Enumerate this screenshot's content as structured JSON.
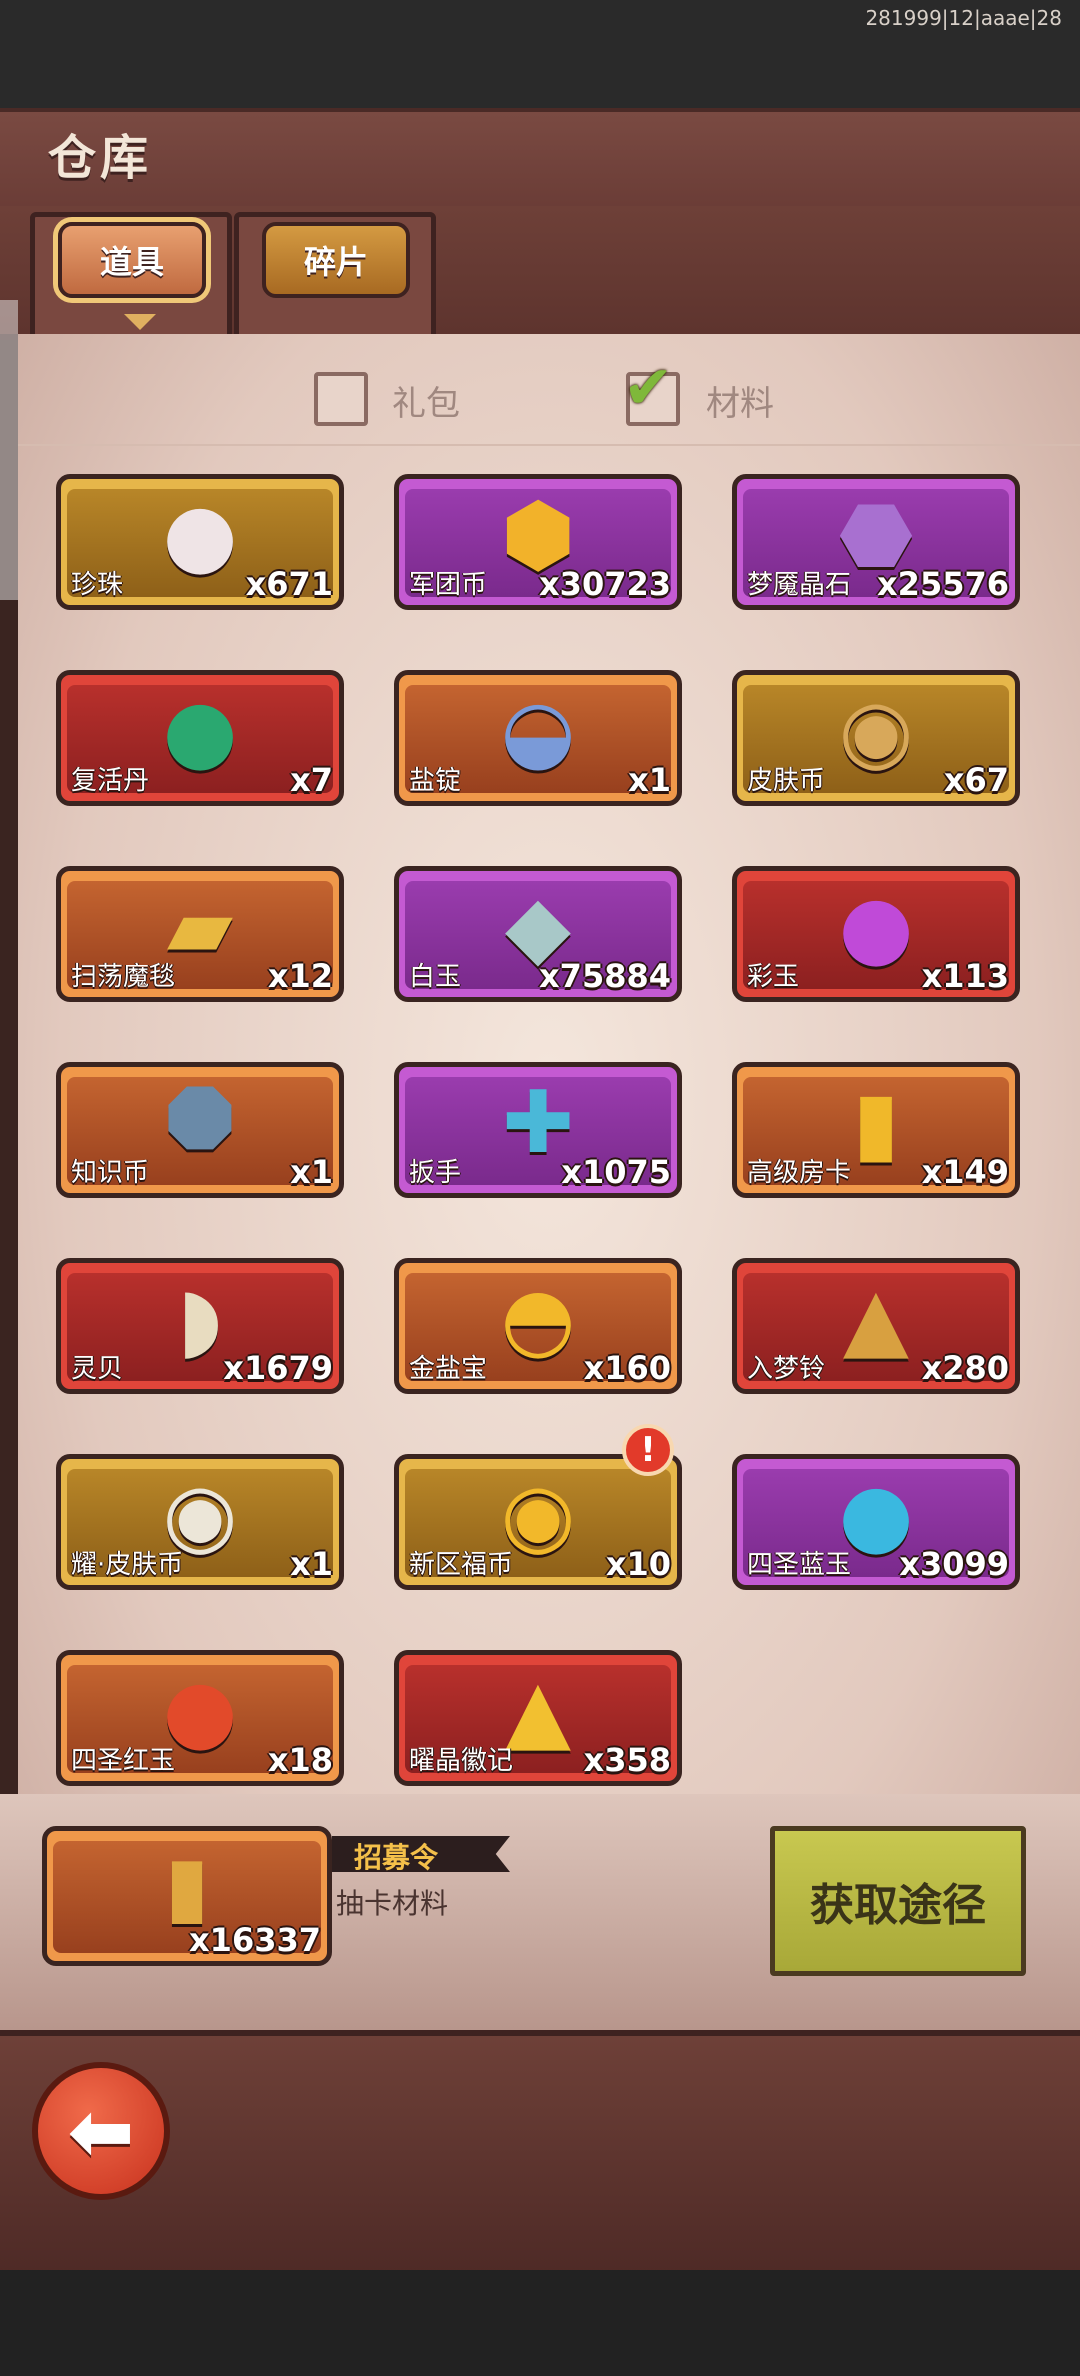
{
  "status_bar": {
    "build_info": "281999|12|aaae|28"
  },
  "header": {
    "title": "仓库"
  },
  "tabs": [
    {
      "label": "道具",
      "active": true
    },
    {
      "label": "碎片",
      "active": false
    }
  ],
  "filters": [
    {
      "label": "礼包",
      "checked": false
    },
    {
      "label": "材料",
      "checked": true
    }
  ],
  "items": [
    {
      "name": "珍珠",
      "qty": "x671",
      "rarity": "gold",
      "icon": "pearl-icon",
      "glyph": "●",
      "color": "#efe4e6"
    },
    {
      "name": "军团币",
      "qty": "x30723",
      "rarity": "purple",
      "icon": "legion-coin-icon",
      "glyph": "⬢",
      "color": "#f2b22a"
    },
    {
      "name": "梦魇晶石",
      "qty": "x25576",
      "rarity": "purple",
      "icon": "nightmare-crystal-icon",
      "glyph": "⬣",
      "color": "#a870d0"
    },
    {
      "name": "复活丹",
      "qty": "x7",
      "rarity": "red",
      "icon": "revive-pill-icon",
      "glyph": "●",
      "color": "#2aa870"
    },
    {
      "name": "盐锭",
      "qty": "x1",
      "rarity": "orange",
      "icon": "salt-ingot-icon",
      "glyph": "◒",
      "color": "#7a9ad8"
    },
    {
      "name": "皮肤币",
      "qty": "x67",
      "rarity": "gold",
      "icon": "skin-coin-icon",
      "glyph": "◉",
      "color": "#d8a85a"
    },
    {
      "name": "扫荡魔毯",
      "qty": "x12",
      "rarity": "orange",
      "icon": "magic-carpet-icon",
      "glyph": "▰",
      "color": "#e8b840"
    },
    {
      "name": "白玉",
      "qty": "x75884",
      "rarity": "purple",
      "icon": "white-jade-icon",
      "glyph": "◆",
      "color": "#a8c8c8"
    },
    {
      "name": "彩玉",
      "qty": "x113",
      "rarity": "red",
      "icon": "rainbow-jade-icon",
      "glyph": "●",
      "color": "#c04ad8"
    },
    {
      "name": "知识币",
      "qty": "x1",
      "rarity": "orange",
      "icon": "knowledge-coin-icon",
      "glyph": "⯃",
      "color": "#6a8aa8"
    },
    {
      "name": "扳手",
      "qty": "x1075",
      "rarity": "purple",
      "icon": "wrench-icon",
      "glyph": "✚",
      "color": "#4ab8d8"
    },
    {
      "name": "高级房卡",
      "qty": "x149",
      "rarity": "orange",
      "icon": "room-card-icon",
      "glyph": "▮",
      "color": "#f0b82a"
    },
    {
      "name": "灵贝",
      "qty": "x1679",
      "rarity": "red",
      "icon": "spirit-shell-icon",
      "glyph": "◗",
      "color": "#e8dcc0"
    },
    {
      "name": "金盐宝",
      "qty": "x160",
      "rarity": "orange",
      "icon": "gold-salt-ingot-icon",
      "glyph": "◓",
      "color": "#f2b82a"
    },
    {
      "name": "入梦铃",
      "qty": "x280",
      "rarity": "red",
      "icon": "dream-bell-icon",
      "glyph": "▲",
      "color": "#d8a040"
    },
    {
      "name": "耀·皮肤币",
      "qty": "x1",
      "rarity": "gold",
      "icon": "radiant-skin-coin-icon",
      "glyph": "◉",
      "color": "#ece6d8"
    },
    {
      "name": "新区福币",
      "qty": "x10",
      "rarity": "gold",
      "icon": "new-server-coin-icon",
      "glyph": "◉",
      "color": "#f2b82a",
      "alert": "!"
    },
    {
      "name": "四圣蓝玉",
      "qty": "x3099",
      "rarity": "purple",
      "icon": "blue-jade-icon",
      "glyph": "●",
      "color": "#3ab8e0"
    },
    {
      "name": "四圣红玉",
      "qty": "x18",
      "rarity": "orange",
      "icon": "red-jade-icon",
      "glyph": "●",
      "color": "#e24a2a"
    },
    {
      "name": "曜晶徽记",
      "qty": "x358",
      "rarity": "red",
      "icon": "crystal-emblem-icon",
      "glyph": "▲",
      "color": "#f2c030"
    }
  ],
  "detail": {
    "name": "招募令",
    "description": "抽卡材料",
    "qty": "x16337",
    "rarity": "orange",
    "icon": "recruit-token-icon",
    "glyph": "▮",
    "color": "#e0a840",
    "action_label": "获取途径"
  },
  "back_button": {
    "icon": "back-arrow-icon",
    "glyph": "⬅"
  }
}
